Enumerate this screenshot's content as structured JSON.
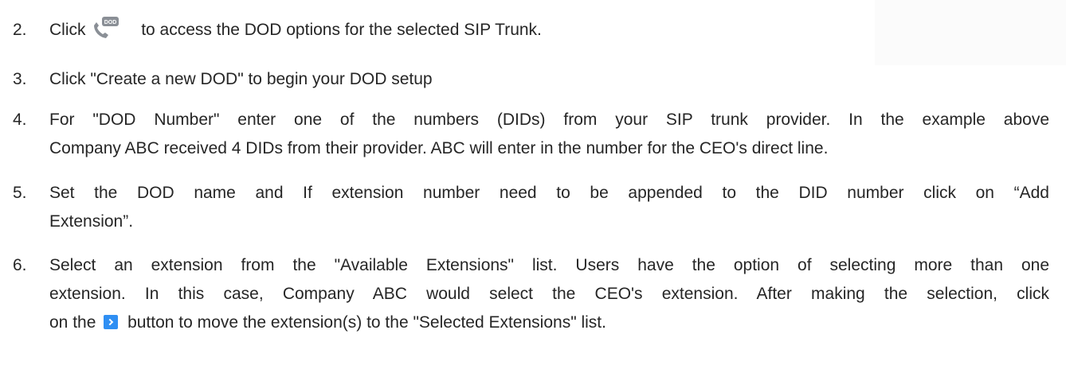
{
  "icons": {
    "dod_icon_label": "DOD",
    "dod_icon_color": "#8a8f96",
    "move_button_color": "#2f8ff3"
  },
  "steps": [
    {
      "number": "2.",
      "text_before": "Click",
      "text_after": "to access the DOD options for the selected SIP Trunk."
    },
    {
      "number": "3.",
      "text": "Click \"Create a new DOD\" to begin your DOD setup"
    },
    {
      "number": "4.",
      "lines": [
        "For \"DOD Number\" enter one of the numbers (DIDs) from your SIP trunk provider. In the example above",
        "Company ABC received 4 DIDs from their provider. ABC will enter in the number for the CEO's direct line."
      ]
    },
    {
      "number": "5.",
      "lines": [
        "Set the DOD name and If extension number need to be appended to the DID number click on “Add",
        "Extension”."
      ]
    },
    {
      "number": "6.",
      "lines": [
        "Select an extension from the \"Available Extensions\" list. Users have the option of selecting more than one",
        "extension. In this case, Company ABC would select the CEO's extension. After making the selection, click"
      ],
      "last_before": "on the",
      "last_after": "button to move the extension(s) to the \"Selected Extensions\" list."
    }
  ]
}
